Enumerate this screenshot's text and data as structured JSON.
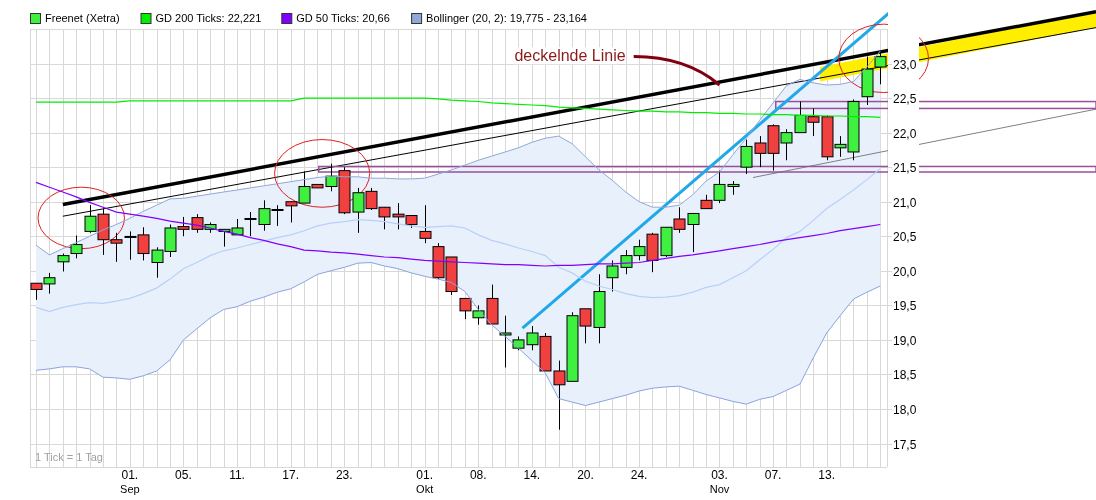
{
  "chart": {
    "legend": [
      {
        "label": "Freenet (Xetra)",
        "color": "#40f040"
      },
      {
        "label": "GD 200 Ticks: 22,221",
        "color": "#00ee00"
      },
      {
        "label": "GD 50 Ticks: 20,66",
        "color": "#8000ff"
      },
      {
        "label": "Bollinger (20, 2): 19,775 - 23,164",
        "color": "#90a8d8"
      }
    ],
    "note": "1 Tick = 1 Tag",
    "chart_data": {
      "type": "candlestick",
      "grid": true,
      "ylim": [
        17.16,
        23.5
      ],
      "categories": [
        null,
        null,
        null,
        null,
        null,
        null,
        null,
        "01.\nSep",
        null,
        null,
        null,
        "05.",
        null,
        null,
        null,
        "11.",
        null,
        null,
        null,
        "17.",
        null,
        null,
        null,
        "23.",
        null,
        null,
        null,
        null,
        null,
        "01.\nOkt",
        null,
        null,
        null,
        "08.",
        null,
        null,
        null,
        "14.",
        null,
        null,
        null,
        "20.",
        null,
        null,
        null,
        "24.",
        null,
        null,
        null,
        null,
        null,
        "03.\nNov",
        null,
        null,
        null,
        "07.",
        null,
        null,
        null,
        "13.",
        null,
        null,
        null,
        null
      ],
      "yticks": [
        {
          "value": 17.5,
          "label": "17,5"
        },
        {
          "value": 18,
          "label": "18,0"
        },
        {
          "value": 18.5,
          "label": "18,5"
        },
        {
          "value": 19,
          "label": "19,0"
        },
        {
          "value": 19.5,
          "label": "19,5"
        },
        {
          "value": 20,
          "label": "20,0"
        },
        {
          "value": 20.5,
          "label": "20,5"
        },
        {
          "value": 21,
          "label": "21,0"
        },
        {
          "value": 21.5,
          "label": "21,5"
        },
        {
          "value": 22,
          "label": "22,0"
        },
        {
          "value": 22.5,
          "label": "22,5"
        },
        {
          "value": 23,
          "label": "23,0"
        }
      ],
      "ohlc": [
        [
          19.82,
          19.82,
          19.58,
          19.73
        ],
        [
          19.81,
          19.97,
          19.67,
          19.9
        ],
        [
          20.13,
          20.25,
          19.99,
          20.22
        ],
        [
          20.25,
          20.51,
          20.18,
          20.38
        ],
        [
          20.57,
          20.95,
          20.55,
          20.79
        ],
        [
          20.82,
          20.9,
          20.23,
          20.45
        ],
        [
          20.45,
          20.55,
          20.13,
          20.4
        ],
        [
          20.49,
          20.57,
          20.16,
          20.49
        ],
        [
          20.52,
          20.63,
          20.15,
          20.25
        ],
        [
          20.12,
          20.34,
          19.9,
          20.3
        ],
        [
          20.28,
          20.67,
          20.2,
          20.62
        ],
        [
          20.64,
          20.78,
          20.5,
          20.6
        ],
        [
          20.77,
          20.82,
          20.55,
          20.6
        ],
        [
          20.6,
          20.7,
          20.55,
          20.67
        ],
        [
          20.57,
          20.6,
          20.35,
          20.6
        ],
        [
          20.52,
          20.75,
          20.52,
          20.62
        ],
        [
          20.75,
          20.85,
          20.5,
          20.75
        ],
        [
          20.67,
          21.02,
          20.58,
          20.9
        ],
        [
          20.88,
          20.95,
          20.65,
          20.88
        ],
        [
          21.0,
          21.0,
          20.7,
          20.94
        ],
        [
          20.98,
          21.44,
          20.98,
          21.22
        ],
        [
          21.25,
          21.25,
          21.2,
          21.2
        ],
        [
          21.22,
          21.55,
          21.15,
          21.37
        ],
        [
          21.45,
          21.5,
          20.82,
          20.84
        ],
        [
          20.85,
          21.2,
          20.55,
          21.13
        ],
        [
          21.15,
          21.2,
          20.88,
          20.9
        ],
        [
          20.92,
          20.92,
          20.6,
          20.78
        ],
        [
          20.82,
          20.98,
          20.6,
          20.78
        ],
        [
          20.8,
          20.8,
          20.62,
          20.67
        ],
        [
          20.57,
          20.95,
          20.4,
          20.47
        ],
        [
          20.35,
          20.4,
          19.88,
          19.9
        ],
        [
          20.2,
          20.2,
          19.65,
          19.7
        ],
        [
          19.6,
          19.6,
          19.3,
          19.42
        ],
        [
          19.32,
          19.5,
          19.22,
          19.42
        ],
        [
          19.6,
          19.8,
          19.23,
          19.23
        ],
        [
          19.08,
          19.35,
          18.6,
          19.1
        ],
        [
          18.88,
          19.05,
          18.85,
          19.0
        ],
        [
          18.93,
          19.2,
          18.85,
          19.1
        ],
        [
          19.05,
          19.1,
          18.55,
          18.55
        ],
        [
          18.55,
          18.7,
          17.7,
          18.35
        ],
        [
          18.4,
          19.4,
          18.4,
          19.35
        ],
        [
          19.45,
          19.45,
          18.95,
          19.2
        ],
        [
          19.18,
          19.95,
          18.95,
          19.7
        ],
        [
          19.9,
          20.15,
          19.7,
          20.07
        ],
        [
          20.05,
          20.3,
          19.95,
          20.22
        ],
        [
          20.22,
          20.45,
          20.15,
          20.35
        ],
        [
          20.53,
          20.55,
          19.98,
          20.15
        ],
        [
          20.22,
          20.63,
          20.2,
          20.63
        ],
        [
          20.75,
          20.92,
          20.55,
          20.6
        ],
        [
          20.67,
          20.83,
          20.27,
          20.83
        ],
        [
          21.02,
          21.1,
          20.9,
          20.9
        ],
        [
          21.02,
          21.45,
          20.98,
          21.25
        ],
        [
          21.22,
          21.3,
          21.1,
          21.25
        ],
        [
          21.5,
          21.9,
          21.4,
          21.8
        ],
        [
          21.85,
          21.95,
          21.5,
          21.7
        ],
        [
          22.1,
          22.12,
          21.45,
          21.7
        ],
        [
          21.85,
          22.05,
          21.6,
          22.0
        ],
        [
          22.0,
          22.45,
          22.0,
          22.25
        ],
        [
          22.23,
          22.35,
          21.95,
          22.15
        ],
        [
          22.23,
          22.25,
          21.6,
          21.65
        ],
        [
          21.78,
          21.95,
          21.65,
          21.83
        ],
        [
          21.72,
          22.48,
          21.6,
          22.45
        ],
        [
          22.52,
          23.1,
          22.4,
          22.92
        ],
        [
          22.95,
          23.15,
          22.7,
          23.1
        ]
      ],
      "annotations": [
        "deckelnde Linie"
      ]
    },
    "indicators": {
      "chart_data": {
        "type": "line",
        "ylim": [
          17.16,
          23.5
        ],
        "series": [
          {
            "color": "#90a8d8",
            "values": [
              20.37,
              20.23,
              20.32,
              20.41,
              20.5,
              20.59,
              20.67,
              20.76,
              20.86,
              20.95,
              21.04,
              21.05,
              21.08,
              21.11,
              21.14,
              21.17,
              21.2,
              21.23,
              21.26,
              21.29,
              21.32,
              21.35,
              21.37,
              21.36,
              21.36,
              21.34,
              21.34,
              21.33,
              21.33,
              21.34,
              21.4,
              21.46,
              21.53,
              21.6,
              21.66,
              21.72,
              21.78,
              21.86,
              21.92,
              21.95,
              21.84,
              21.65,
              21.46,
              21.31,
              21.14,
              21.0,
              20.92,
              20.92,
              20.95,
              21.1,
              21.3,
              21.43,
              21.68,
              21.92,
              22.18,
              22.43,
              22.68,
              22.77,
              22.72,
              22.69,
              22.7,
              22.74,
              22.95,
              23.18
            ]
          },
          {
            "color": "#8ca4dc",
            "values": [
              18.56,
              18.58,
              18.61,
              18.61,
              18.58,
              18.46,
              18.45,
              18.43,
              18.48,
              18.55,
              18.71,
              19.0,
              19.16,
              19.32,
              19.44,
              19.48,
              19.56,
              19.62,
              19.69,
              19.74,
              19.84,
              19.95,
              20.0,
              20.05,
              20.11,
              20.12,
              20.07,
              20.03,
              19.97,
              19.92,
              19.88,
              19.83,
              19.7,
              19.44,
              19.22,
              19.05,
              18.88,
              18.7,
              18.52,
              18.15,
              18.1,
              18.05,
              18.1,
              18.15,
              18.2,
              18.26,
              18.3,
              18.32,
              18.33,
              18.27,
              18.21,
              18.16,
              18.11,
              18.07,
              18.14,
              18.18,
              18.27,
              18.36,
              18.74,
              19.1,
              19.35,
              19.59,
              19.69,
              19.78
            ]
          },
          {
            "color": "#b8d0f8",
            "values": [
              19.47,
              19.41,
              19.47,
              19.51,
              19.54,
              19.53,
              19.56,
              19.6,
              19.67,
              19.75,
              19.88,
              20.03,
              20.12,
              20.22,
              20.29,
              20.33,
              20.38,
              20.43,
              20.48,
              20.52,
              20.58,
              20.65,
              20.69,
              20.71,
              20.74,
              20.73,
              20.71,
              20.68,
              20.65,
              20.63,
              20.64,
              20.65,
              20.62,
              20.52,
              20.44,
              20.39,
              20.33,
              20.28,
              20.22,
              20.05,
              19.97,
              19.85,
              19.78,
              19.73,
              19.67,
              19.63,
              19.61,
              19.62,
              19.64,
              19.69,
              19.76,
              19.8,
              19.9,
              20.0,
              20.16,
              20.31,
              20.48,
              20.57,
              20.73,
              20.9,
              21.03,
              21.17,
              21.32,
              21.48
            ]
          },
          {
            "color": "#00ee00",
            "values": [
              22.44,
              22.44,
              22.44,
              22.44,
              22.44,
              22.44,
              22.44,
              22.46,
              22.46,
              22.46,
              22.46,
              22.46,
              22.46,
              22.46,
              22.46,
              22.46,
              22.46,
              22.46,
              22.46,
              22.46,
              22.5,
              22.5,
              22.5,
              22.5,
              22.5,
              22.5,
              22.5,
              22.5,
              22.5,
              22.5,
              22.49,
              22.47,
              22.46,
              22.45,
              22.43,
              22.42,
              22.41,
              22.4,
              22.39,
              22.37,
              22.36,
              22.35,
              22.34,
              22.33,
              22.32,
              22.31,
              22.31,
              22.3,
              22.3,
              22.29,
              22.29,
              22.28,
              22.28,
              22.27,
              22.27,
              22.26,
              22.26,
              22.25,
              22.25,
              22.24,
              22.24,
              22.23,
              22.23,
              22.22
            ]
          },
          {
            "color": "#8000ff",
            "values": [
              21.28,
              21.21,
              21.14,
              21.07,
              20.99,
              20.92,
              20.85,
              20.82,
              20.79,
              20.76,
              20.72,
              20.69,
              20.66,
              20.62,
              20.57,
              20.53,
              20.48,
              20.44,
              20.39,
              20.35,
              20.3,
              20.29,
              20.27,
              20.26,
              20.24,
              20.22,
              20.2,
              20.19,
              20.17,
              20.15,
              20.14,
              20.13,
              20.12,
              20.11,
              20.1,
              20.09,
              20.09,
              20.08,
              20.07,
              20.08,
              20.08,
              20.09,
              20.1,
              20.1,
              20.11,
              20.12,
              20.15,
              20.18,
              20.21,
              20.23,
              20.26,
              20.29,
              20.32,
              20.35,
              20.38,
              20.42,
              20.45,
              20.48,
              20.51,
              20.54,
              20.58,
              20.61,
              20.64,
              20.67
            ]
          }
        ]
      }
    }
  }
}
